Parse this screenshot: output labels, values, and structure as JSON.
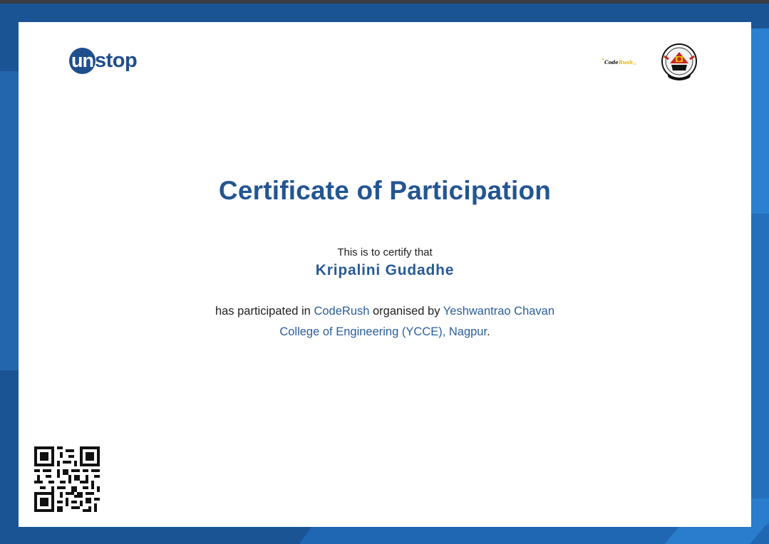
{
  "brand": {
    "logo_prefix": "un",
    "logo_suffix": "stop",
    "event_logo_text": "CodeRush"
  },
  "certificate": {
    "title": "Certificate of Participation",
    "intro": "This is to certify that",
    "recipient_name": "Kripalini Gudadhe",
    "text_before_event": "has participated in ",
    "event_name": "CodeRush",
    "text_between": " organised by ",
    "organiser": "Yeshwantrao Chavan College of Engineering (YCCE), Nagpur",
    "text_end": "."
  },
  "colors": {
    "brand_blue": "#245591",
    "background_blue": "#1b5495"
  }
}
